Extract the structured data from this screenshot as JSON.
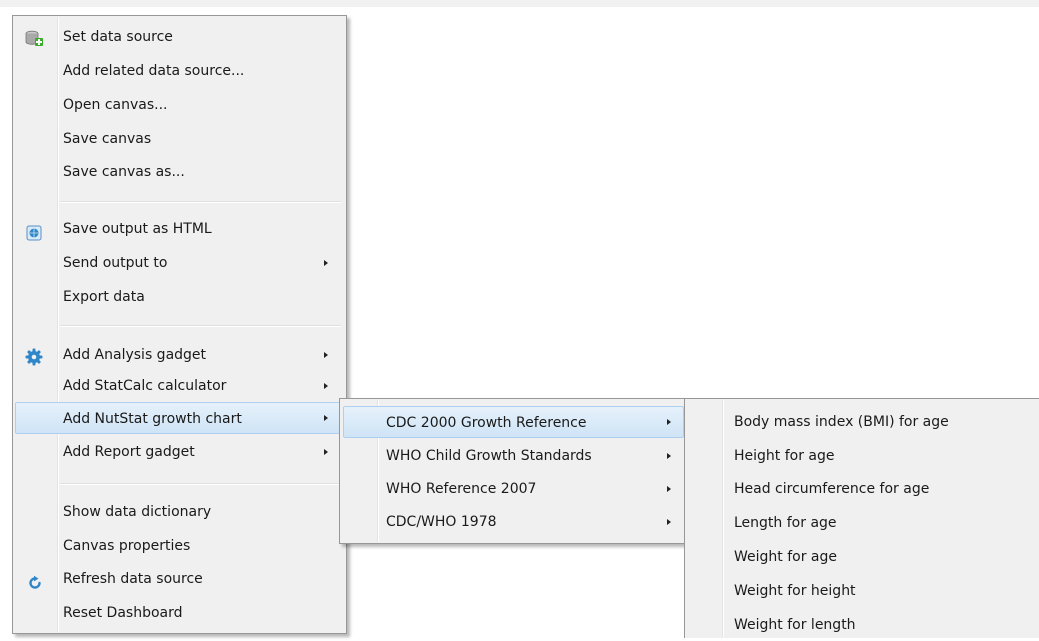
{
  "main_menu": {
    "items": [
      {
        "label": "Set data source",
        "icon": "add-database-icon"
      },
      {
        "label": "Add related data source..."
      },
      {
        "label": "Open canvas..."
      },
      {
        "label": "Save canvas"
      },
      {
        "label": "Save canvas as..."
      },
      {
        "label": "Save output as HTML",
        "icon": "html-globe-icon"
      },
      {
        "label": "Send output to",
        "submenu": true
      },
      {
        "label": "Export data"
      },
      {
        "label": "Add Analysis gadget",
        "icon": "gear-icon",
        "submenu": true
      },
      {
        "label": "Add StatCalc calculator",
        "submenu": true
      },
      {
        "label": "Add NutStat growth chart",
        "submenu": true,
        "highlighted": true
      },
      {
        "label": "Add Report gadget",
        "submenu": true
      },
      {
        "label": "Show data dictionary"
      },
      {
        "label": "Canvas properties"
      },
      {
        "label": "Refresh data source",
        "icon": "refresh-icon"
      },
      {
        "label": "Reset Dashboard"
      }
    ]
  },
  "growth_menu": {
    "items": [
      {
        "label": "CDC 2000 Growth Reference",
        "submenu": true,
        "highlighted": true
      },
      {
        "label": "WHO Child Growth Standards",
        "submenu": true
      },
      {
        "label": "WHO Reference 2007",
        "submenu": true
      },
      {
        "label": "CDC/WHO 1978",
        "submenu": true
      }
    ]
  },
  "cdc_menu": {
    "items": [
      {
        "label": "Body mass index (BMI) for age"
      },
      {
        "label": "Height for age"
      },
      {
        "label": "Head circumference for age"
      },
      {
        "label": "Length for age"
      },
      {
        "label": "Weight for age"
      },
      {
        "label": "Weight for height"
      },
      {
        "label": "Weight for length"
      }
    ]
  },
  "colors": {
    "menu_background": "#f0f0f0",
    "highlight": "#cfe4f6",
    "highlight_border": "#aecff0",
    "icon_green": "#3cab2c",
    "icon_blue": "#2f86c9"
  }
}
